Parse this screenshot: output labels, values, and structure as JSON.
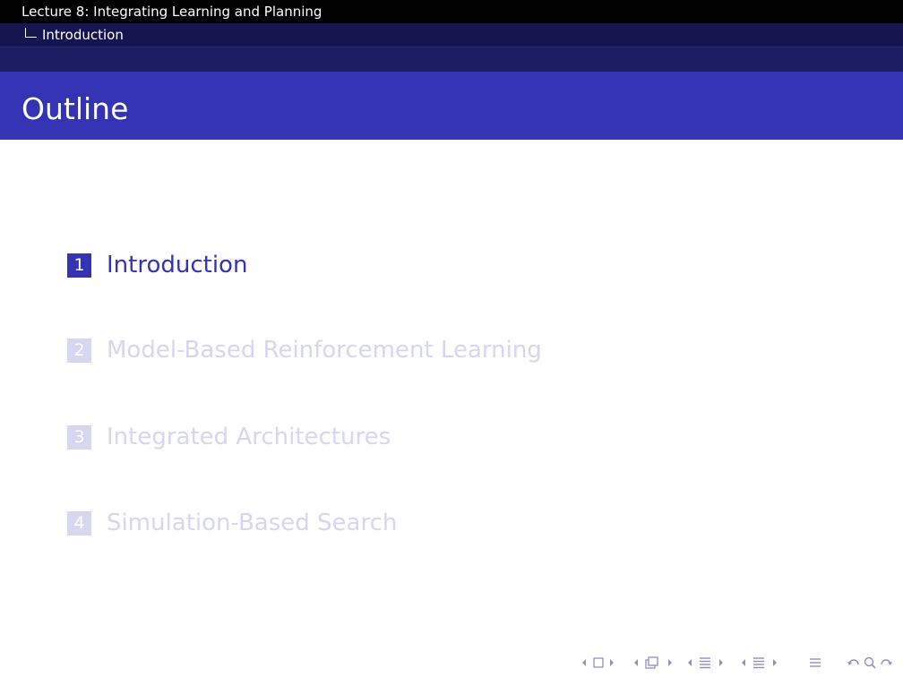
{
  "header": {
    "lecture_title": "Lecture 8: Integrating Learning and Planning",
    "section": "Introduction"
  },
  "frame": {
    "title": "Outline"
  },
  "toc": [
    {
      "number": "1",
      "label": "Introduction",
      "state": "active"
    },
    {
      "number": "2",
      "label": "Model-Based Reinforcement Learning",
      "state": "dimmed"
    },
    {
      "number": "3",
      "label": "Integrated Architectures",
      "state": "dimmed"
    },
    {
      "number": "4",
      "label": "Simulation-Based Search",
      "state": "dimmed"
    }
  ],
  "navigation": {
    "icons": [
      "prev-arrow-icon",
      "frame-icon",
      "next-arrow-icon",
      "prev-arrow-icon",
      "subsection-icon",
      "next-arrow-icon",
      "prev-arrow-icon",
      "section-icon",
      "next-arrow-icon",
      "prev-arrow-icon",
      "section-icon",
      "next-arrow-icon",
      "align-icon",
      "undo-icon",
      "search-icon",
      "redo-icon"
    ]
  },
  "colors": {
    "header_top": "#000000",
    "header_sub": "#15154f",
    "title_bar": "#3333b3",
    "toc_active": "#3333b3",
    "toc_dimmed": "#d6d6f0",
    "nav_icons": "#8f8fc8"
  }
}
